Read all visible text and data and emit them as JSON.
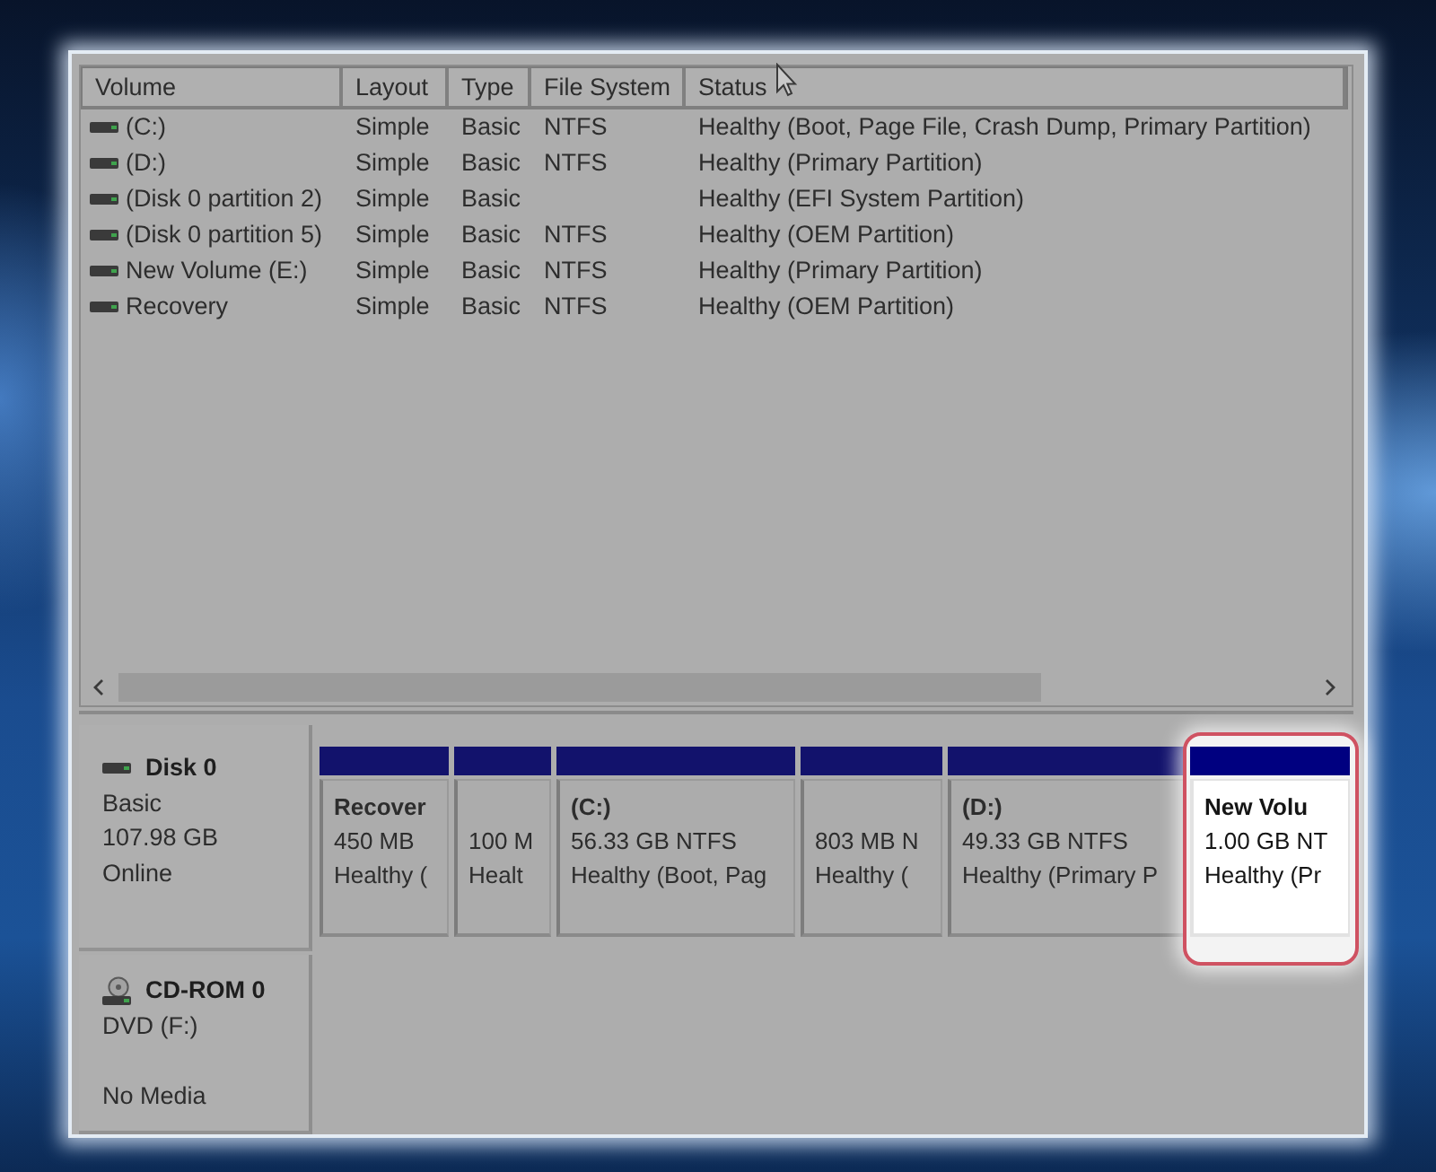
{
  "volume_list": {
    "columns": [
      "Volume",
      "Layout",
      "Type",
      "File System",
      "Status"
    ],
    "rows": [
      {
        "volume": "(C:)",
        "layout": "Simple",
        "type": "Basic",
        "file_system": "NTFS",
        "status": "Healthy (Boot, Page File, Crash Dump, Primary Partition)"
      },
      {
        "volume": "(D:)",
        "layout": "Simple",
        "type": "Basic",
        "file_system": "NTFS",
        "status": "Healthy (Primary Partition)"
      },
      {
        "volume": "(Disk 0 partition 2)",
        "layout": "Simple",
        "type": "Basic",
        "status": "Healthy (EFI System Partition)"
      },
      {
        "volume": "(Disk 0 partition 5)",
        "layout": "Simple",
        "type": "Basic",
        "file_system": "NTFS",
        "status": "Healthy (OEM Partition)"
      },
      {
        "volume": "New Volume (E:)",
        "layout": "Simple",
        "type": "Basic",
        "file_system": "NTFS",
        "status": "Healthy (Primary Partition)"
      },
      {
        "volume": "Recovery",
        "layout": "Simple",
        "type": "Basic",
        "file_system": "NTFS",
        "status": "Healthy (OEM Partition)"
      }
    ]
  },
  "disks": [
    {
      "kind": "disk",
      "name": "Disk 0",
      "type": "Basic",
      "size": "107.98 GB",
      "state": "Online",
      "partitions": [
        {
          "title": "Recover",
          "size": "450 MB",
          "status": "Healthy (",
          "highlighted": false
        },
        {
          "size": "100 M",
          "status": "Healt",
          "highlighted": false
        },
        {
          "title": "(C:)",
          "size": "56.33 GB NTFS",
          "status": "Healthy (Boot, Pag",
          "highlighted": false
        },
        {
          "size": "803 MB N",
          "status": "Healthy (",
          "highlighted": false
        },
        {
          "title": "(D:)",
          "size": "49.33 GB NTFS",
          "status": "Healthy (Primary P",
          "highlighted": false
        },
        {
          "title": "New Volu",
          "size": "1.00 GB NT",
          "status": "Healthy (Pr",
          "highlighted": true
        }
      ]
    },
    {
      "kind": "cdrom",
      "name": "CD-ROM 0",
      "type": "DVD (F:)",
      "state": "No Media"
    }
  ]
}
